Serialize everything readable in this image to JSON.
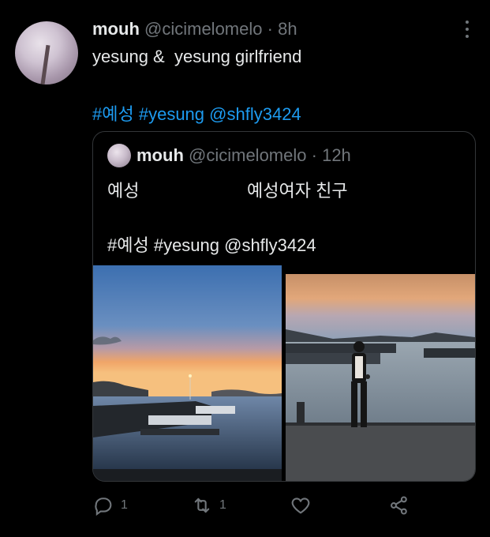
{
  "tweet": {
    "display_name": "mouh",
    "handle": "@cicimelomelo",
    "separator": "·",
    "time": "8h",
    "text": "yesung &  yesung girlfriend",
    "tags": [
      "#예성",
      "#yesung",
      "@shfly3424"
    ]
  },
  "quoted": {
    "display_name": "mouh",
    "handle": "@cicimelomelo",
    "separator": "·",
    "time": "12h",
    "line1_left": "예성",
    "line1_right": "예성여자 친구",
    "tags_line": "#예성 #yesung @shfly3424"
  },
  "actions": {
    "reply_count": "1",
    "retweet_count": "1"
  },
  "icons": {
    "more": "more-icon",
    "reply": "reply-icon",
    "retweet": "retweet-icon",
    "like": "heart-icon",
    "share": "share-icon"
  },
  "colors": {
    "background": "#000000",
    "text": "#e7e9ea",
    "secondary": "#71767b",
    "link": "#1d9bf0",
    "border": "#333639"
  }
}
